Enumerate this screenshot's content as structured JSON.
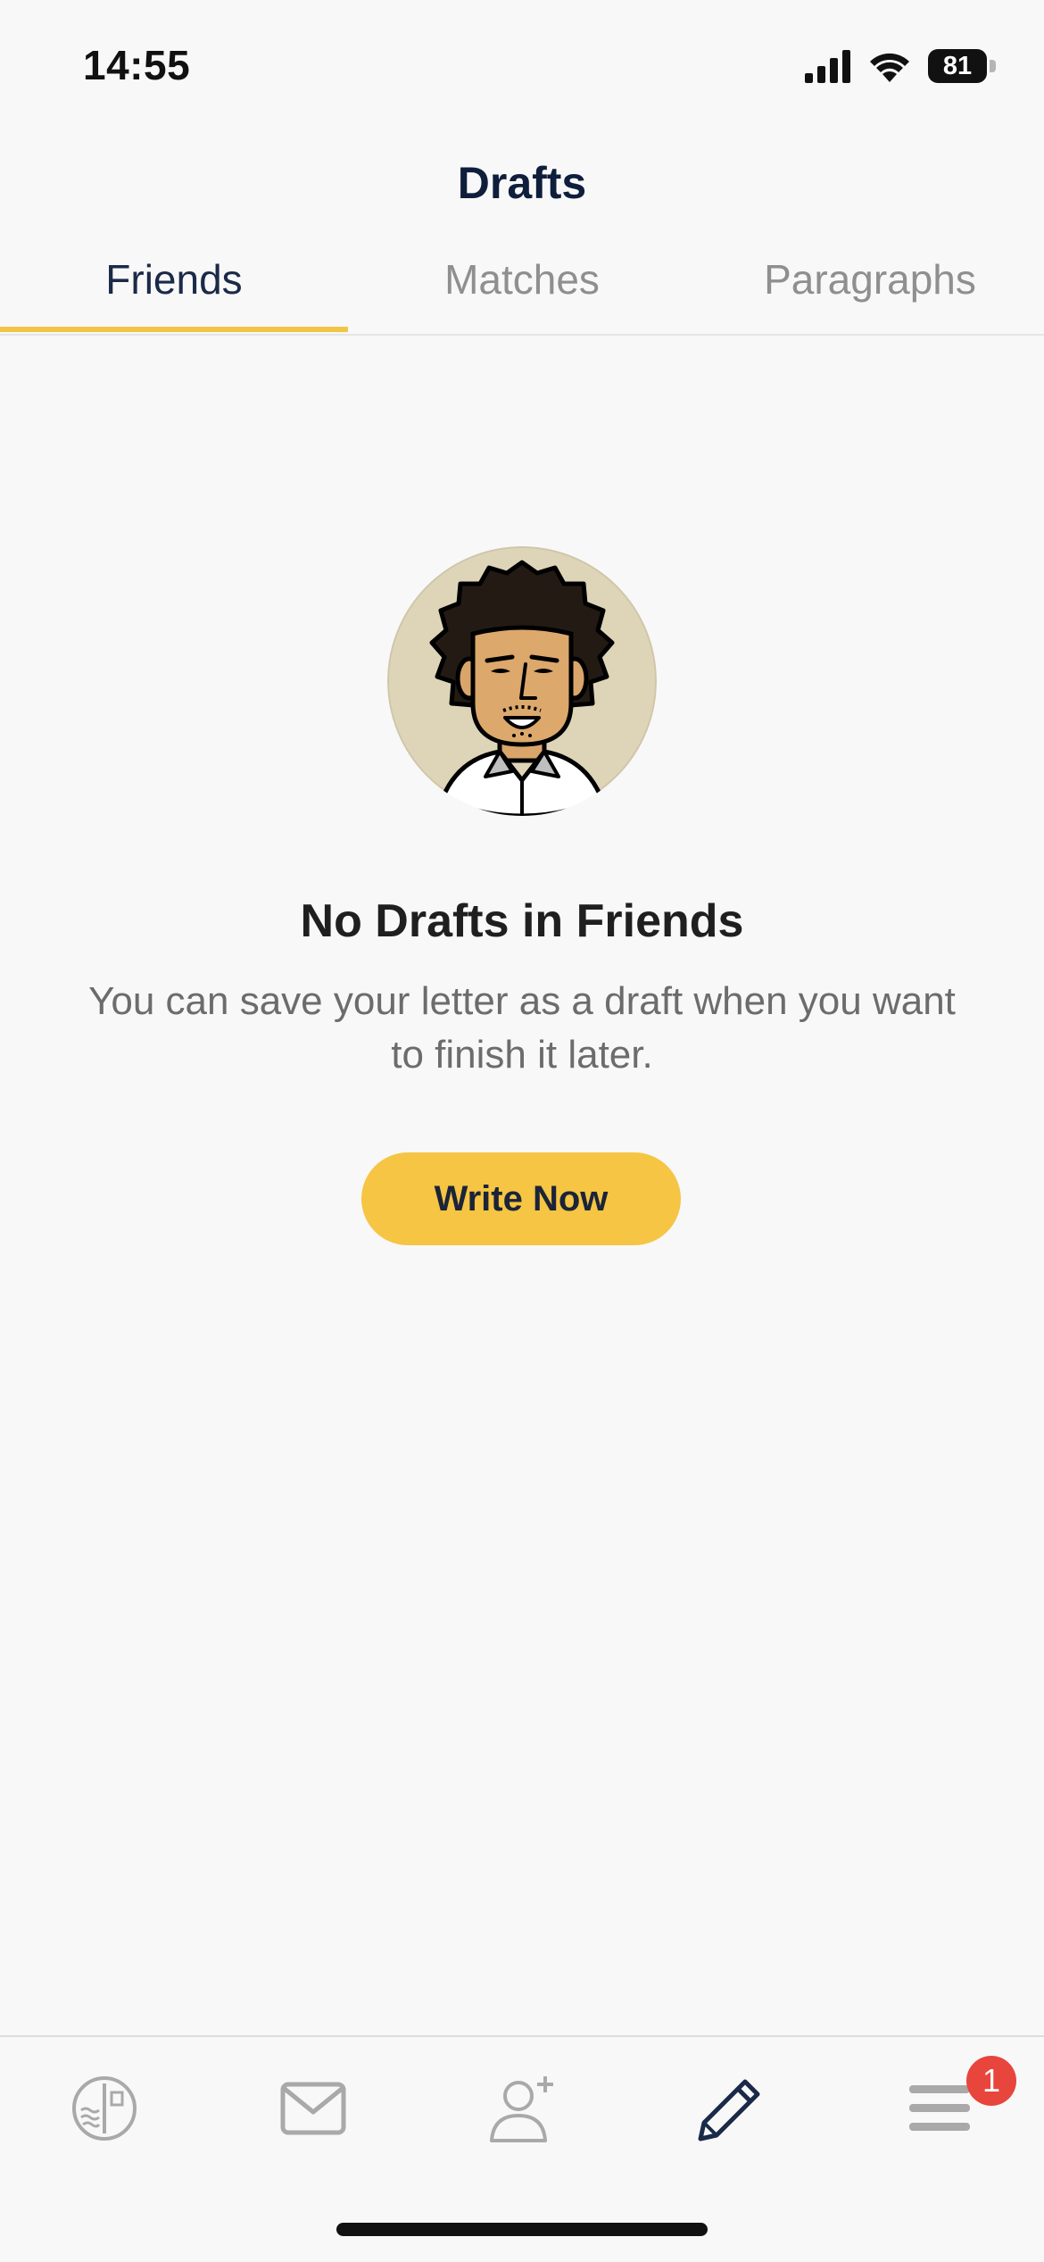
{
  "status_bar": {
    "time": "14:55",
    "battery": "81",
    "icons": [
      "signal-icon",
      "wifi-icon",
      "battery-icon"
    ]
  },
  "header": {
    "title": "Drafts"
  },
  "tabs": [
    {
      "label": "Friends",
      "active": true
    },
    {
      "label": "Matches",
      "active": false
    },
    {
      "label": "Paragraphs",
      "active": false
    }
  ],
  "empty_state": {
    "title": "No Drafts in Friends",
    "description": "You can save your letter as a draft when you want to finish it later.",
    "button_label": "Write Now",
    "avatar": "avatar-illustration"
  },
  "tab_bar": {
    "items": [
      {
        "icon": "stamp-icon",
        "active": false
      },
      {
        "icon": "mail-icon",
        "active": false
      },
      {
        "icon": "add-friend-icon",
        "active": false
      },
      {
        "icon": "pencil-icon",
        "active": true
      },
      {
        "icon": "menu-icon",
        "active": false
      }
    ],
    "menu_badge": "1"
  },
  "colors": {
    "accent": "#f5c543",
    "active_text": "#1a2a48",
    "inactive_text": "#8f8f8f",
    "badge": "#e8453c",
    "background": "#f8f8f8"
  }
}
